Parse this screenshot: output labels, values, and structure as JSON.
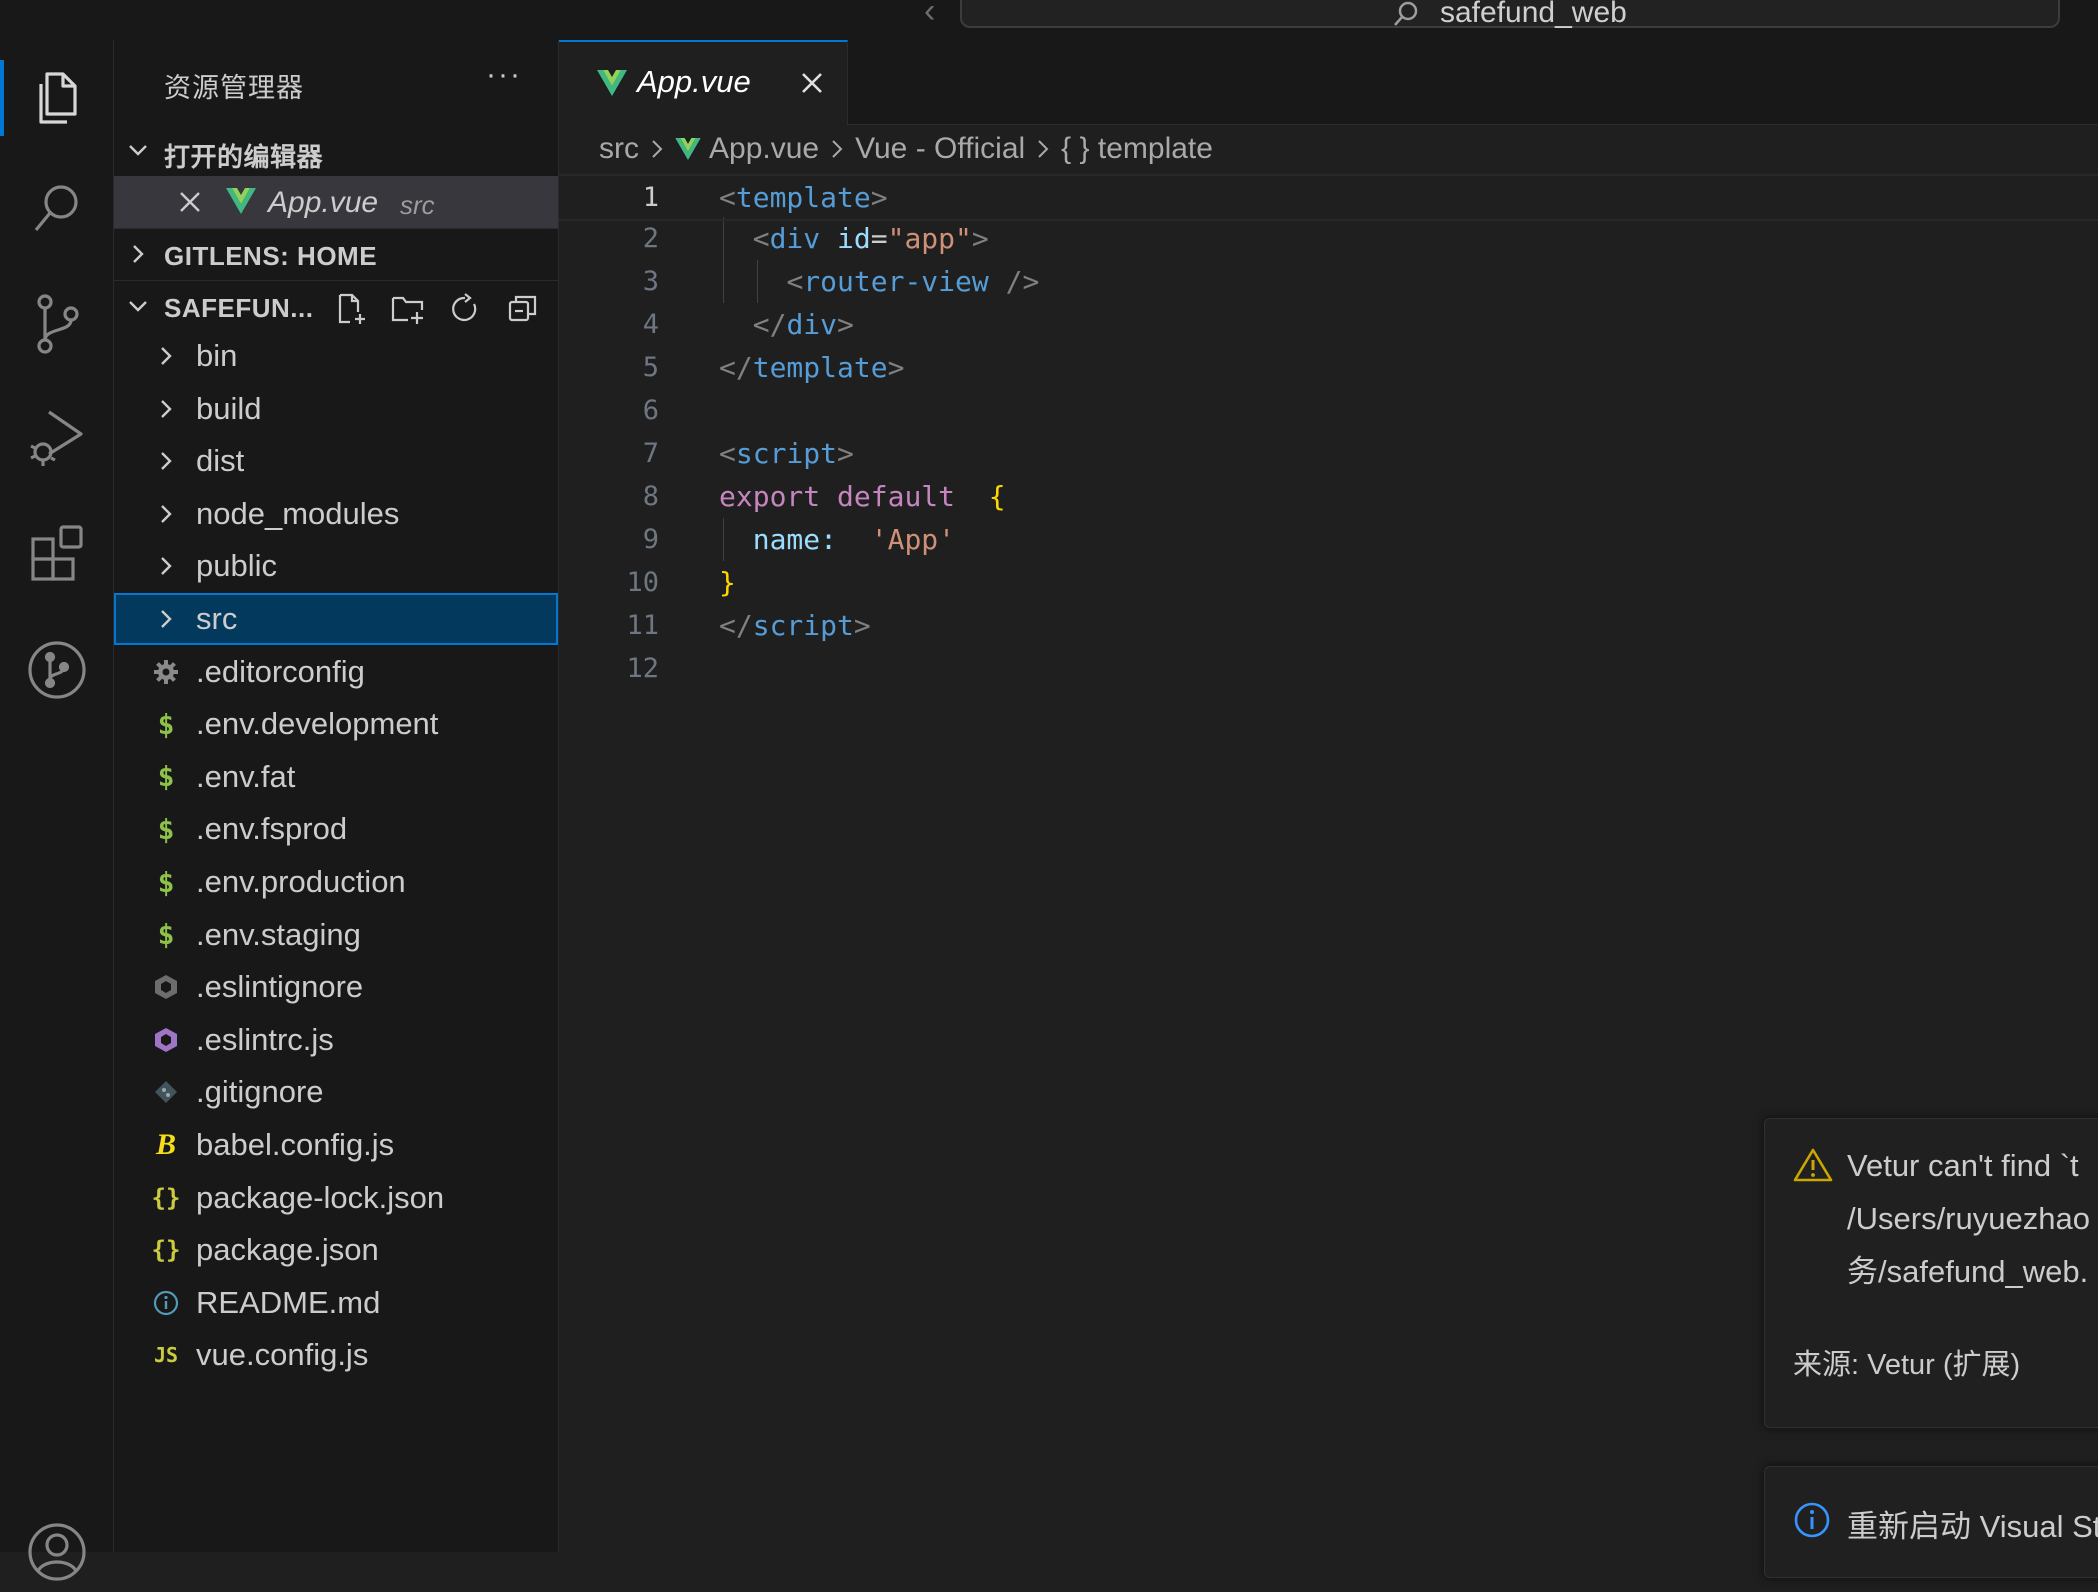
{
  "window": {
    "title": "safefund_web"
  },
  "activity_bar": {
    "items": [
      {
        "icon": "explorer-icon",
        "active": true
      },
      {
        "icon": "search-icon"
      },
      {
        "icon": "source-control-icon"
      },
      {
        "icon": "run-debug-icon"
      },
      {
        "icon": "extensions-icon"
      },
      {
        "icon": "gitlens-icon"
      },
      {
        "icon": "account-icon"
      }
    ]
  },
  "sidebar": {
    "title": "资源管理器",
    "more": "···",
    "open_editors": {
      "label": "打开的编辑器",
      "items": [
        {
          "name": "App.vue",
          "dir": "src"
        }
      ]
    },
    "gitlens": {
      "label": "GITLENS: HOME"
    },
    "project": {
      "label": "SAFEFUN...",
      "toolbar": [
        "new-file-icon",
        "new-folder-icon",
        "refresh-icon",
        "collapse-all-icon"
      ],
      "items": [
        {
          "name": "bin",
          "type": "folder"
        },
        {
          "name": "build",
          "type": "folder"
        },
        {
          "name": "dist",
          "type": "folder"
        },
        {
          "name": "node_modules",
          "type": "folder"
        },
        {
          "name": "public",
          "type": "folder"
        },
        {
          "name": "src",
          "type": "folder",
          "selected": true
        },
        {
          "name": ".editorconfig",
          "type": "gear"
        },
        {
          "name": ".env.development",
          "type": "dollar"
        },
        {
          "name": ".env.fat",
          "type": "dollar"
        },
        {
          "name": ".env.fsprod",
          "type": "dollar"
        },
        {
          "name": ".env.production",
          "type": "dollar"
        },
        {
          "name": ".env.staging",
          "type": "dollar"
        },
        {
          "name": ".eslintignore",
          "type": "eslint-gray"
        },
        {
          "name": ".eslintrc.js",
          "type": "eslint"
        },
        {
          "name": ".gitignore",
          "type": "git"
        },
        {
          "name": "babel.config.js",
          "type": "babel"
        },
        {
          "name": "package-lock.json",
          "type": "json"
        },
        {
          "name": "package.json",
          "type": "json"
        },
        {
          "name": "README.md",
          "type": "info"
        },
        {
          "name": "vue.config.js",
          "type": "js"
        }
      ]
    }
  },
  "editor": {
    "tab": {
      "label": "App.vue"
    },
    "breadcrumb": [
      "src",
      "App.vue",
      "Vue - Official",
      "{ } template"
    ],
    "current_line": 1,
    "lines": [
      [
        [
          "t-punc",
          "<"
        ],
        [
          "t-tag",
          "template"
        ],
        [
          "t-punc",
          ">"
        ]
      ],
      [
        [
          "t-text",
          "  "
        ],
        [
          "t-punc",
          "<"
        ],
        [
          "t-tag",
          "div"
        ],
        [
          "t-text",
          " "
        ],
        [
          "t-attr",
          "id"
        ],
        [
          "t-text",
          "="
        ],
        [
          "t-str",
          "\"app\""
        ],
        [
          "t-punc",
          ">"
        ]
      ],
      [
        [
          "t-text",
          "    "
        ],
        [
          "t-punc",
          "<"
        ],
        [
          "t-tag",
          "router-view"
        ],
        [
          "t-text",
          " "
        ],
        [
          "t-punc",
          "/>"
        ]
      ],
      [
        [
          "t-text",
          "  "
        ],
        [
          "t-punc",
          "</"
        ],
        [
          "t-tag",
          "div"
        ],
        [
          "t-punc",
          ">"
        ]
      ],
      [
        [
          "t-punc",
          "</"
        ],
        [
          "t-tag",
          "template"
        ],
        [
          "t-punc",
          ">"
        ]
      ],
      [],
      [
        [
          "t-punc",
          "<"
        ],
        [
          "t-tag",
          "script"
        ],
        [
          "t-punc",
          ">"
        ]
      ],
      [
        [
          "t-kw",
          "export"
        ],
        [
          "t-text",
          " "
        ],
        [
          "t-kw",
          "default"
        ],
        [
          "t-text",
          "  "
        ],
        [
          "t-brace",
          "{"
        ]
      ],
      [
        [
          "t-text",
          "  "
        ],
        [
          "t-prop",
          "name:"
        ],
        [
          "t-text",
          "  "
        ],
        [
          "t-str",
          "'App'"
        ]
      ],
      [
        [
          "t-brace",
          "}"
        ]
      ],
      [
        [
          "t-punc",
          "</"
        ],
        [
          "t-tag",
          "script"
        ],
        [
          "t-punc",
          ">"
        ]
      ],
      []
    ]
  },
  "notifications": {
    "warning": {
      "lines": [
        "Vetur can't find `t",
        "/Users/ruyuezhao",
        "务/safefund_web."
      ],
      "source": "来源: Vetur (扩展)"
    },
    "info": {
      "message": "重新启动 Visual St"
    }
  }
}
